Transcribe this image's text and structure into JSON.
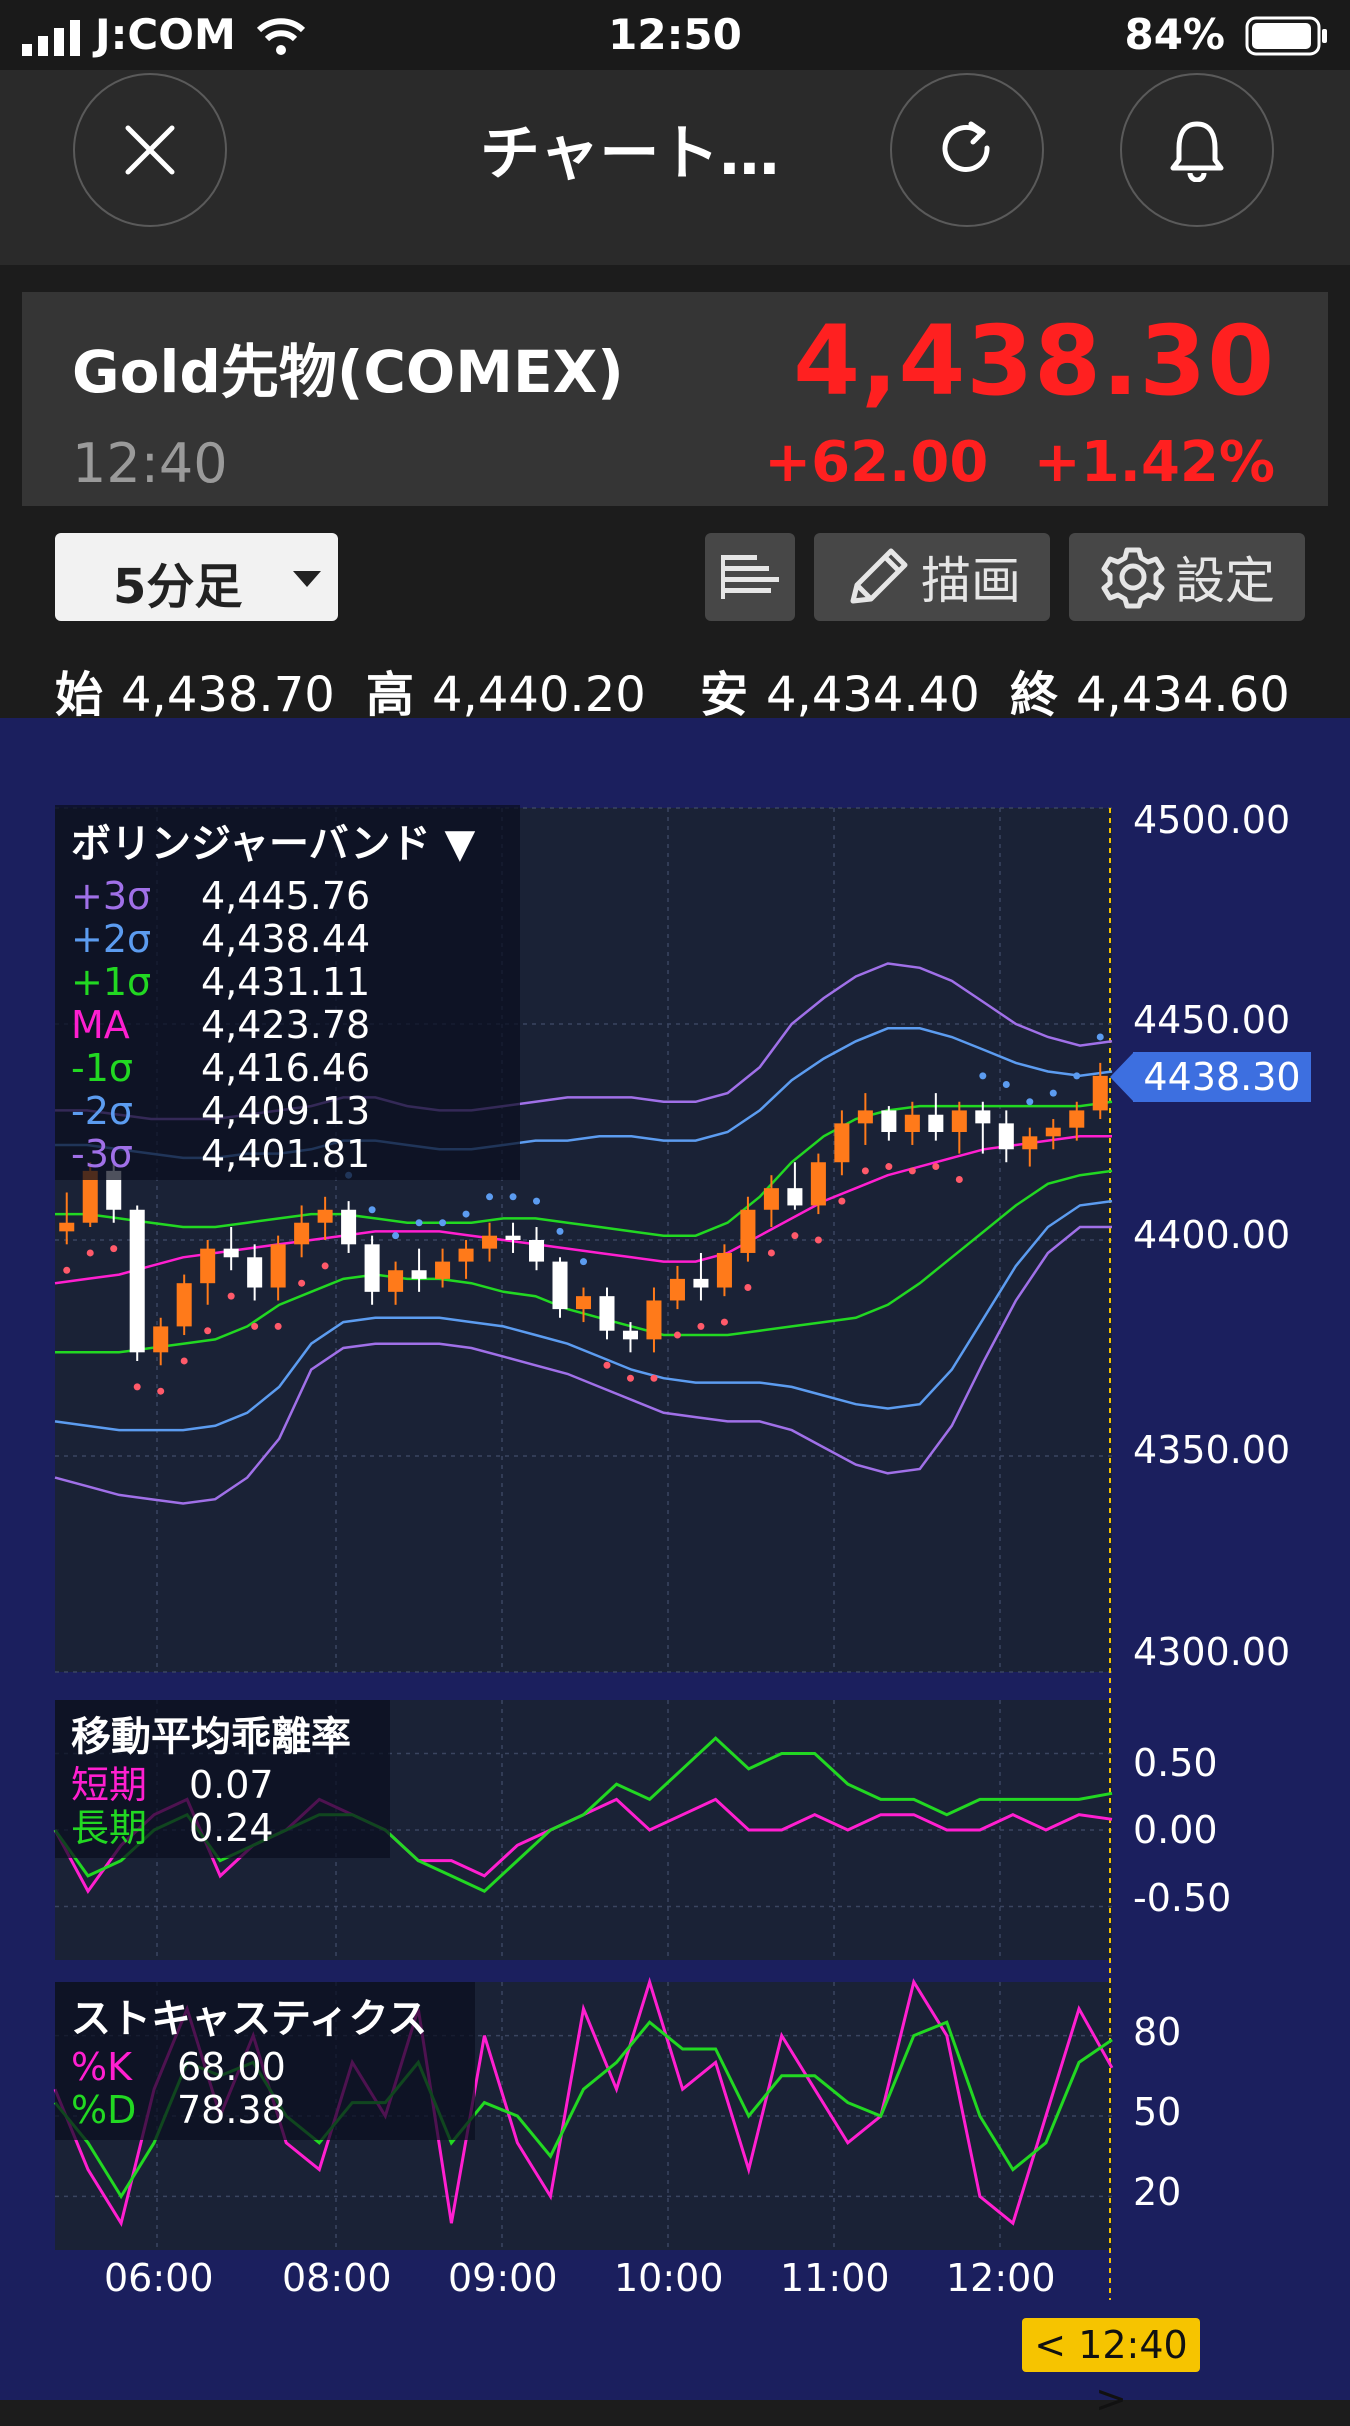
{
  "status_bar": {
    "carrier": "J:COM",
    "time": "12:50",
    "battery": "84%"
  },
  "header": {
    "title": "チャート…",
    "close_icon": "close-icon",
    "reload_icon": "reload-icon",
    "bell_icon": "bell-icon"
  },
  "instrument": {
    "name": "Gold先物(COMEX)",
    "time": "12:40",
    "price": "4,438.30",
    "change": "+62.00",
    "change_pct": "+1.42%",
    "up_color": "#ff2020"
  },
  "controls": {
    "period": "5分足",
    "draw": "描画",
    "settings": "設定"
  },
  "ohlc": {
    "open_label": "始",
    "open": "4,438.70",
    "high_label": "高",
    "high": "4,440.20",
    "low_label": "安",
    "low": "4,434.40",
    "close_label": "終",
    "close": "4,434.60"
  },
  "bollinger": {
    "title": "ボリンジャーバンド ▼",
    "rows": [
      {
        "name": "+3σ",
        "value": "4,445.76",
        "color": "#a070e8"
      },
      {
        "name": "+2σ",
        "value": "4,438.44",
        "color": "#5c9cf0"
      },
      {
        "name": "+1σ",
        "value": "4,431.11",
        "color": "#22d822"
      },
      {
        "name": "MA",
        "value": "4,423.78",
        "color": "#ff1fd0"
      },
      {
        "name": "-1σ",
        "value": "4,416.46",
        "color": "#22d822"
      },
      {
        "name": "-2σ",
        "value": "4,409.13",
        "color": "#5c9cf0"
      },
      {
        "name": "-3σ",
        "value": "4,401.81",
        "color": "#a070e8"
      }
    ]
  },
  "deviation": {
    "title": "移動平均乖離率",
    "rows": [
      {
        "name": "短期",
        "value": "0.07",
        "color": "#ff1fd0"
      },
      {
        "name": "長期",
        "value": "0.24",
        "color": "#22d822"
      }
    ]
  },
  "stochastic": {
    "title": "ストキャスティクス",
    "rows": [
      {
        "name": "%K",
        "value": "68.00",
        "color": "#ff1fd0"
      },
      {
        "name": "%D",
        "value": "78.38",
        "color": "#22d822"
      }
    ]
  },
  "price_tag": "4438.30",
  "time_tag": "< 12:40 >",
  "chart_data": {
    "type": "line",
    "y_ticks": [
      "4500.00",
      "4450.00",
      "4400.00",
      "4350.00",
      "4300.00"
    ],
    "dev_ticks": [
      "0.50",
      "0.00",
      "-0.50"
    ],
    "stoch_ticks": [
      "80",
      "50",
      "20"
    ],
    "x_ticks": [
      "06:00",
      "08:00",
      "09:00",
      "10:00",
      "11:00",
      "12:00"
    ],
    "ylim": [
      4300,
      4500
    ],
    "series": [
      {
        "name": "+3σ",
        "color": "#a070e8",
        "values": [
          4430,
          4430,
          4429,
          4428,
          4428,
          4428,
          4429,
          4430,
          4431,
          4433,
          4433,
          4431,
          4430,
          4430,
          4431,
          4432,
          4433,
          4433,
          4433,
          4432,
          4432,
          4434,
          4440,
          4450,
          4456,
          4461,
          4464,
          4463,
          4460,
          4455,
          4450,
          4447,
          4445,
          4446
        ]
      },
      {
        "name": "+2σ",
        "color": "#5c9cf0",
        "values": [
          4422,
          4422,
          4421,
          4420,
          4419,
          4419,
          4420,
          4420,
          4421,
          4423,
          4423,
          4422,
          4421,
          4421,
          4422,
          4423,
          4423,
          4424,
          4424,
          4423,
          4423,
          4425,
          4430,
          4437,
          4442,
          4446,
          4449,
          4449,
          4447,
          4444,
          4441,
          4439,
          4438,
          4439
        ]
      },
      {
        "name": "+1σ",
        "color": "#22d822",
        "values": [
          4406,
          4406,
          4405,
          4404,
          4403,
          4403,
          4404,
          4405,
          4406,
          4406,
          4405,
          4404,
          4404,
          4404,
          4405,
          4405,
          4404,
          4403,
          4402,
          4401,
          4401,
          4404,
          4410,
          4418,
          4424,
          4428,
          4430,
          4431,
          4431,
          4431,
          4431,
          4431,
          4431,
          4432
        ]
      },
      {
        "name": "MA",
        "color": "#ff1fd0",
        "values": [
          4390,
          4391,
          4392,
          4394,
          4396,
          4397,
          4398,
          4399,
          4400,
          4401,
          4402,
          4402,
          4402,
          4401,
          4400,
          4399,
          4398,
          4397,
          4396,
          4395,
          4395,
          4397,
          4401,
          4405,
          4409,
          4412,
          4415,
          4417,
          4419,
          4421,
          4422,
          4423,
          4424,
          4424
        ]
      },
      {
        "name": "-1σ",
        "color": "#22d822",
        "values": [
          4374,
          4374,
          4374,
          4375,
          4376,
          4377,
          4380,
          4385,
          4388,
          4391,
          4392,
          4391,
          4391,
          4390,
          4388,
          4387,
          4384,
          4382,
          4380,
          4378,
          4378,
          4378,
          4379,
          4380,
          4381,
          4382,
          4385,
          4390,
          4396,
          4402,
          4408,
          4413,
          4415,
          4416
        ]
      },
      {
        "name": "-2σ",
        "color": "#5c9cf0",
        "values": [
          4358,
          4357,
          4356,
          4356,
          4356,
          4357,
          4360,
          4366,
          4376,
          4381,
          4382,
          4382,
          4382,
          4381,
          4380,
          4378,
          4376,
          4373,
          4370,
          4368,
          4367,
          4367,
          4367,
          4366,
          4364,
          4362,
          4361,
          4362,
          4370,
          4382,
          4394,
          4403,
          4408,
          4409
        ]
      },
      {
        "name": "-3σ",
        "color": "#a070e8",
        "values": [
          4345,
          4343,
          4341,
          4340,
          4339,
          4340,
          4345,
          4354,
          4370,
          4375,
          4376,
          4376,
          4376,
          4375,
          4373,
          4371,
          4369,
          4366,
          4363,
          4360,
          4359,
          4358,
          4358,
          4356,
          4352,
          4348,
          4346,
          4347,
          4357,
          4372,
          4386,
          4397,
          4403,
          4403
        ]
      },
      {
        "name": "短期",
        "color": "#ff1fd0",
        "values": [
          0.0,
          -0.4,
          -0.1,
          0.1,
          0.2,
          -0.3,
          -0.1,
          0.0,
          0.2,
          0.1,
          0.0,
          -0.2,
          -0.2,
          -0.3,
          -0.1,
          0.0,
          0.1,
          0.2,
          0.0,
          0.1,
          0.2,
          0.0,
          0.0,
          0.1,
          0.0,
          0.1,
          0.1,
          0.0,
          0.0,
          0.1,
          0.0,
          0.1,
          0.07
        ]
      },
      {
        "name": "長期",
        "color": "#22d822",
        "values": [
          0.0,
          -0.3,
          -0.2,
          0.0,
          0.1,
          -0.2,
          -0.1,
          0.0,
          0.1,
          0.1,
          0.0,
          -0.2,
          -0.3,
          -0.4,
          -0.2,
          0.0,
          0.1,
          0.3,
          0.2,
          0.4,
          0.6,
          0.4,
          0.5,
          0.5,
          0.3,
          0.2,
          0.2,
          0.1,
          0.2,
          0.2,
          0.2,
          0.2,
          0.24
        ]
      },
      {
        "name": "%K",
        "color": "#ff1fd0",
        "values": [
          60,
          30,
          10,
          60,
          90,
          50,
          80,
          40,
          30,
          70,
          50,
          90,
          10,
          80,
          40,
          20,
          90,
          60,
          100,
          60,
          70,
          30,
          80,
          60,
          40,
          50,
          100,
          80,
          20,
          10,
          50,
          90,
          68
        ]
      },
      {
        "name": "%D",
        "color": "#22d822",
        "values": [
          55,
          40,
          20,
          40,
          70,
          65,
          70,
          50,
          40,
          55,
          55,
          70,
          40,
          55,
          50,
          35,
          60,
          70,
          85,
          75,
          75,
          50,
          65,
          65,
          55,
          50,
          80,
          85,
          50,
          30,
          40,
          70,
          78.38
        ]
      }
    ],
    "candles": [
      [
        4402,
        4411,
        4399,
        4404
      ],
      [
        4404,
        4418,
        4403,
        4416
      ],
      [
        4416,
        4420,
        4404,
        4407
      ],
      [
        4407,
        4408,
        4372,
        4374
      ],
      [
        4374,
        4382,
        4371,
        4380
      ],
      [
        4380,
        4392,
        4378,
        4390
      ],
      [
        4390,
        4400,
        4385,
        4398
      ],
      [
        4398,
        4403,
        4393,
        4396
      ],
      [
        4396,
        4399,
        4386,
        4389
      ],
      [
        4389,
        4401,
        4386,
        4399
      ],
      [
        4399,
        4408,
        4396,
        4404
      ],
      [
        4404,
        4410,
        4400,
        4407
      ],
      [
        4407,
        4409,
        4397,
        4399
      ],
      [
        4399,
        4401,
        4385,
        4388
      ],
      [
        4388,
        4395,
        4385,
        4393
      ],
      [
        4393,
        4398,
        4388,
        4391
      ],
      [
        4391,
        4398,
        4389,
        4395
      ],
      [
        4395,
        4400,
        4391,
        4398
      ],
      [
        4398,
        4404,
        4395,
        4401
      ],
      [
        4401,
        4404,
        4397,
        4400
      ],
      [
        4400,
        4403,
        4393,
        4395
      ],
      [
        4395,
        4396,
        4382,
        4384
      ],
      [
        4384,
        4389,
        4381,
        4387
      ],
      [
        4387,
        4389,
        4377,
        4379
      ],
      [
        4379,
        4381,
        4374,
        4377
      ],
      [
        4377,
        4389,
        4374,
        4386
      ],
      [
        4386,
        4394,
        4384,
        4391
      ],
      [
        4391,
        4397,
        4386,
        4389
      ],
      [
        4389,
        4399,
        4387,
        4397
      ],
      [
        4397,
        4410,
        4395,
        4407
      ],
      [
        4407,
        4415,
        4403,
        4412
      ],
      [
        4412,
        4418,
        4407,
        4408
      ],
      [
        4408,
        4420,
        4406,
        4418
      ],
      [
        4418,
        4430,
        4415,
        4427
      ],
      [
        4427,
        4434,
        4422,
        4430
      ],
      [
        4430,
        4431,
        4423,
        4425
      ],
      [
        4425,
        4432,
        4422,
        4429
      ],
      [
        4429,
        4434,
        4423,
        4425
      ],
      [
        4425,
        4432,
        4420,
        4430
      ],
      [
        4430,
        4432,
        4420,
        4427
      ],
      [
        4427,
        4430,
        4418,
        4421
      ],
      [
        4421,
        4426,
        4417,
        4424
      ],
      [
        4424,
        4428,
        4421,
        4426
      ],
      [
        4426,
        4432,
        4423,
        4430
      ],
      [
        4430,
        4441,
        4428,
        4438
      ]
    ]
  }
}
